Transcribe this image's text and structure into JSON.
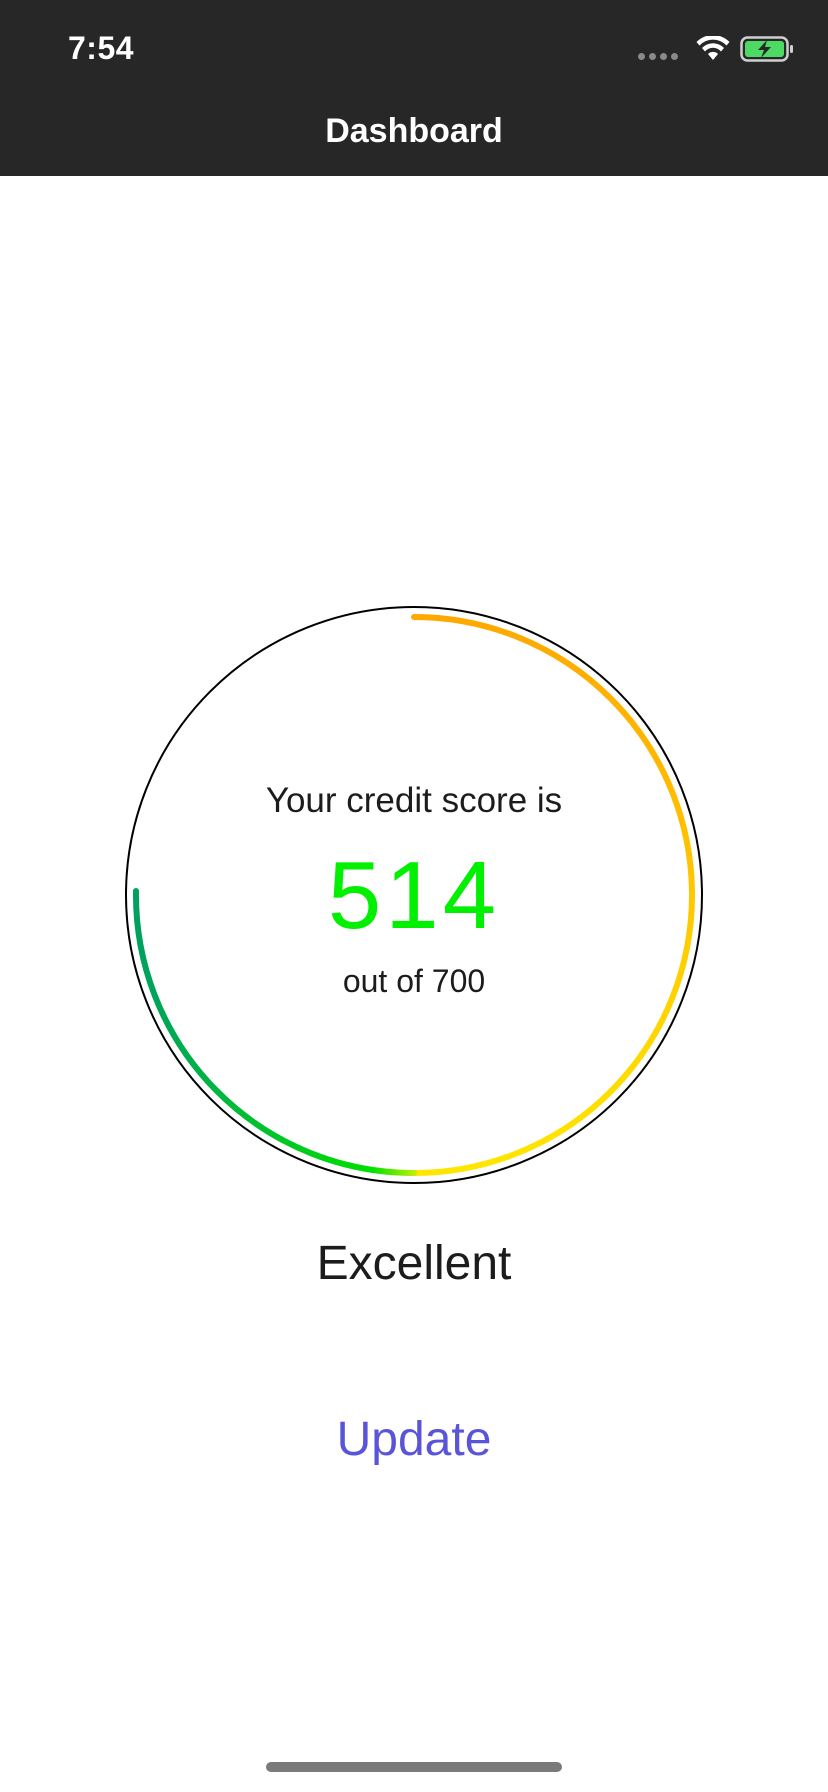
{
  "status_bar": {
    "time": "7:54",
    "icons": [
      "signal-dots-icon",
      "wifi-icon",
      "battery-charging-icon"
    ]
  },
  "nav": {
    "title": "Dashboard"
  },
  "score": {
    "intro": "Your credit score is",
    "value": "514",
    "max_label": "out of 700",
    "score_number": 514,
    "max_number": 700,
    "rating": "Excellent"
  },
  "actions": {
    "update_label": "Update"
  },
  "colors": {
    "status_bar_bg": "#272727",
    "score_green": "#00f000",
    "button_purple": "#5a55d8",
    "gauge_orange": "#ffa800",
    "gauge_yellow": "#ffe600",
    "gauge_green": "#00d000",
    "gauge_dark_green": "#00a060"
  }
}
